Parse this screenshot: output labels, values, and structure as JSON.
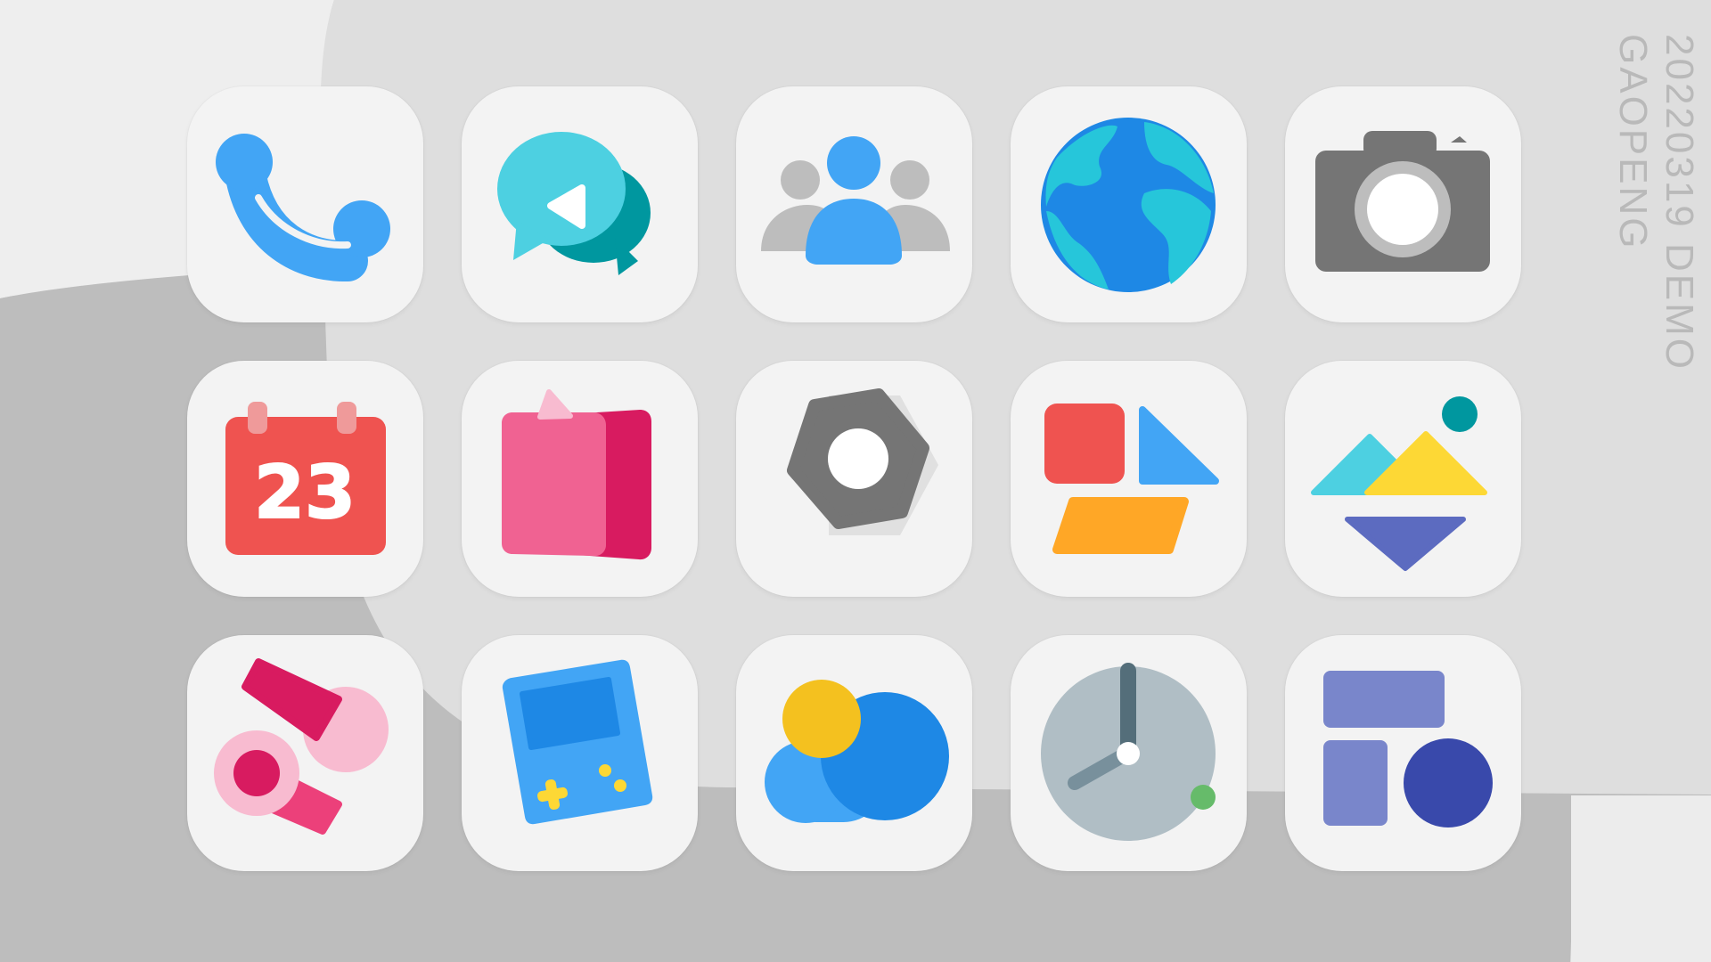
{
  "watermark": {
    "line1": "20220319 DEMO",
    "line2": "GAOPENG"
  },
  "icons": [
    {
      "name": "phone-icon"
    },
    {
      "name": "messages-icon"
    },
    {
      "name": "contacts-icon"
    },
    {
      "name": "browser-icon"
    },
    {
      "name": "camera-icon"
    },
    {
      "name": "calendar-icon",
      "label": "23"
    },
    {
      "name": "notes-icon"
    },
    {
      "name": "settings-icon"
    },
    {
      "name": "app-store-icon"
    },
    {
      "name": "gallery-icon"
    },
    {
      "name": "music-icon"
    },
    {
      "name": "game-center-icon"
    },
    {
      "name": "weather-icon"
    },
    {
      "name": "clock-icon"
    },
    {
      "name": "widgets-icon"
    }
  ],
  "colors": {
    "background": "#e6e6e6",
    "tile": "#f3f3f3",
    "blue": "#42a5f5",
    "red": "#ef5350",
    "pink": "#f06292",
    "magenta": "#d81b60",
    "gray": "#757575",
    "yellow": "#f4c11f",
    "indigo": "#7986cb"
  }
}
